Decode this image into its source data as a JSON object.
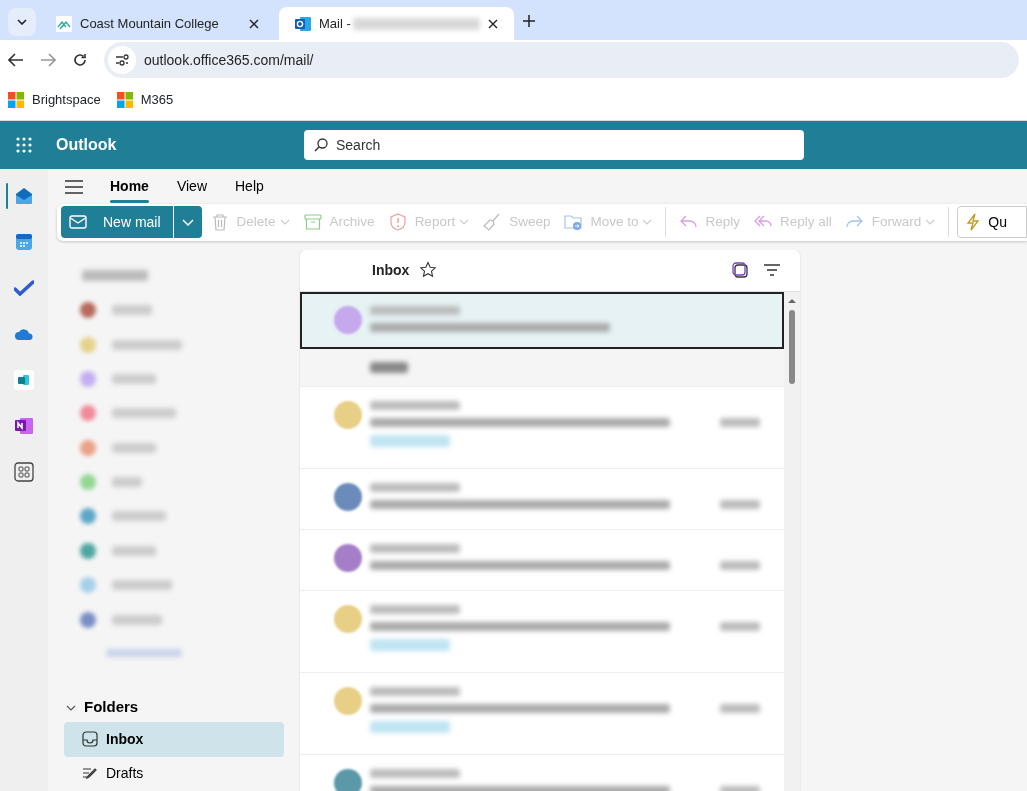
{
  "browser": {
    "tabs": [
      {
        "title": "Coast Mountain College",
        "kind": "college",
        "selected": false
      },
      {
        "title": "Mail - ",
        "kind": "outlook",
        "selected": true
      }
    ],
    "address": "outlook.office365.com/mail/",
    "bookmarks": [
      "Brightspace",
      "M365"
    ]
  },
  "app": {
    "name": "Outlook",
    "search": {
      "placeholder": "Search"
    }
  },
  "rail": [
    {
      "kind": "mail",
      "selected": true
    },
    {
      "kind": "calendar",
      "selected": false
    },
    {
      "kind": "todo",
      "selected": false
    },
    {
      "kind": "cloud",
      "selected": false
    },
    {
      "kind": "exchange",
      "selected": false
    },
    {
      "kind": "onenote",
      "selected": false
    },
    {
      "kind": "apps",
      "selected": false
    }
  ],
  "ribbon_tabs": [
    {
      "label": "Home",
      "selected": true
    },
    {
      "label": "View",
      "selected": false
    },
    {
      "label": "Help",
      "selected": false
    }
  ],
  "toolbar": {
    "new_mail": "New mail",
    "actions": [
      {
        "label": "Delete",
        "dropdown": true,
        "disabled": true
      },
      {
        "label": "Archive",
        "dropdown": false,
        "disabled": true
      },
      {
        "label": "Report",
        "dropdown": true,
        "disabled": true
      },
      {
        "label": "Sweep",
        "dropdown": false,
        "disabled": true
      },
      {
        "label": "Move to",
        "dropdown": true,
        "disabled": true
      },
      {
        "label": "Reply",
        "dropdown": false,
        "disabled": true
      },
      {
        "label": "Reply all",
        "dropdown": false,
        "disabled": true
      },
      {
        "label": "Forward",
        "dropdown": true,
        "disabled": true
      }
    ],
    "quick_steps": "Qu"
  },
  "favorites": [
    {
      "color": "#b86a5c"
    },
    {
      "color": "#e6d28a"
    },
    {
      "color": "#c4aef2"
    },
    {
      "color": "#f08a98"
    },
    {
      "color": "#eba088"
    },
    {
      "color": "#92d892"
    },
    {
      "color": "#5ea6c8"
    },
    {
      "color": "#4fa6a0"
    },
    {
      "color": "#a6d0ea"
    },
    {
      "color": "#7a8ec6"
    }
  ],
  "folders": {
    "label": "Folders",
    "expanded": true,
    "items": [
      {
        "label": "Inbox",
        "selected": true
      },
      {
        "label": "Drafts",
        "selected": false
      }
    ]
  },
  "message_list": {
    "title": "Inbox",
    "rows": [
      {
        "kind": "message",
        "color": "#c6a8ec",
        "selected": true,
        "tagged": false
      },
      {
        "kind": "group"
      },
      {
        "kind": "message",
        "color": "#e8cf86",
        "selected": false,
        "tagged": true
      },
      {
        "kind": "message",
        "color": "#6b8cba",
        "selected": false,
        "tagged": false
      },
      {
        "kind": "message",
        "color": "#a47ec6",
        "selected": false,
        "tagged": false
      },
      {
        "kind": "message",
        "color": "#e8cf86",
        "selected": false,
        "tagged": true
      },
      {
        "kind": "message",
        "color": "#e8cf86",
        "selected": false,
        "tagged": true
      },
      {
        "kind": "message",
        "color": "#5b98a8",
        "selected": false,
        "tagged": false
      }
    ]
  }
}
